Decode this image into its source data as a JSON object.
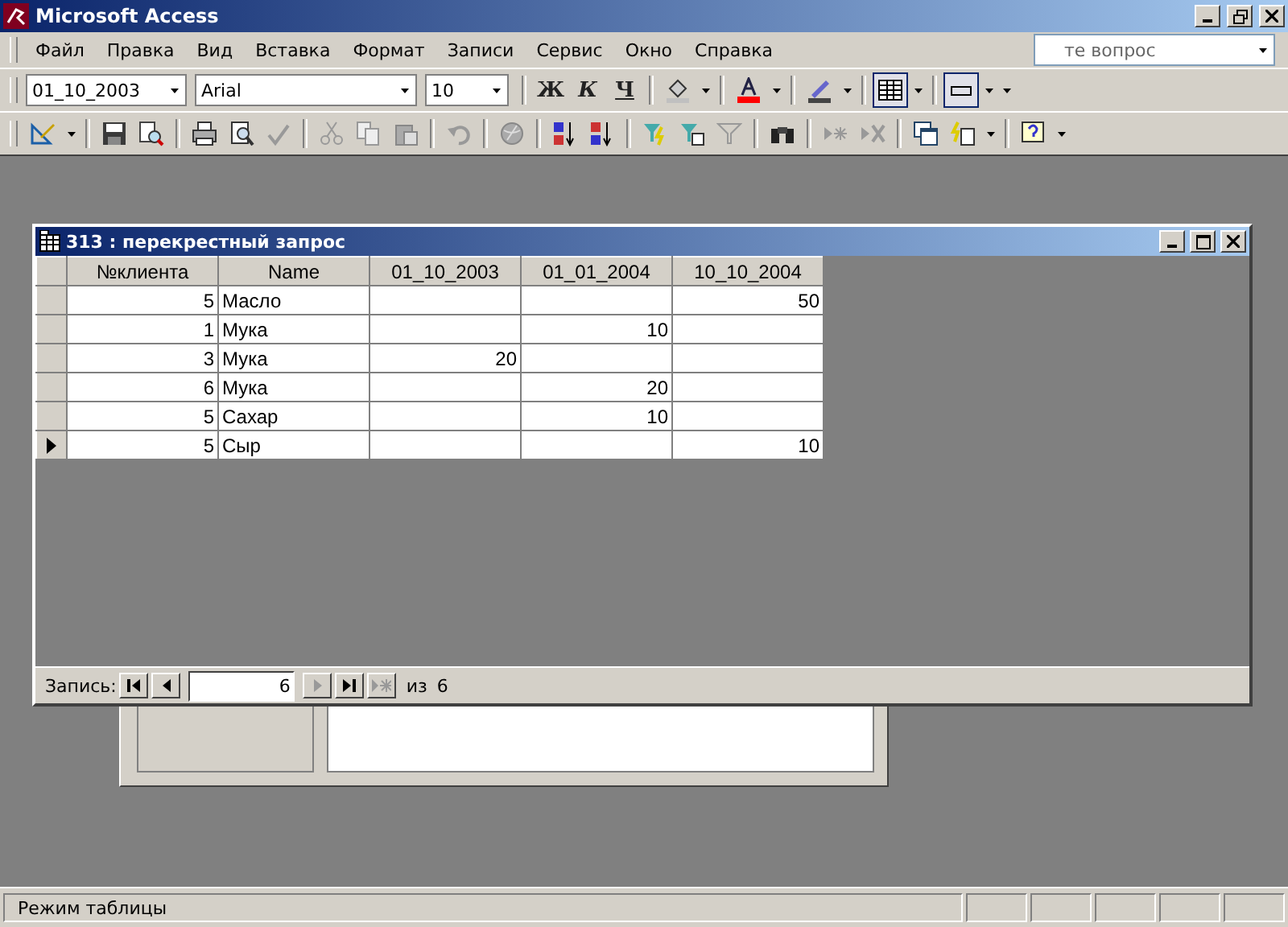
{
  "window": {
    "title": "Microsoft Access"
  },
  "menu": [
    {
      "label": "Файл"
    },
    {
      "label": "Правка"
    },
    {
      "label": "Вид"
    },
    {
      "label": "Вставка"
    },
    {
      "label": "Формат"
    },
    {
      "label": "Записи"
    },
    {
      "label": "Сервис"
    },
    {
      "label": "Окно"
    },
    {
      "label": "Справка"
    }
  ],
  "help_box": {
    "placeholder": "те вопрос"
  },
  "formatting_toolbar": {
    "object_box": "01_10_2003",
    "font_box": "Arial",
    "size_box": "10",
    "bold": "Ж",
    "italic": "К",
    "underline": "Ч"
  },
  "datasheet": {
    "title": "313 : перекрестный запрос",
    "columns": [
      "№клиента",
      "Name",
      "01_10_2003",
      "01_01_2004",
      "10_10_2004"
    ],
    "rows": [
      {
        "current": false,
        "cells": [
          "5",
          "Масло",
          "",
          "",
          "50"
        ]
      },
      {
        "current": false,
        "cells": [
          "1",
          "Мука",
          "",
          "10",
          ""
        ]
      },
      {
        "current": false,
        "cells": [
          "3",
          "Мука",
          "20",
          "",
          ""
        ]
      },
      {
        "current": false,
        "cells": [
          "6",
          "Мука",
          "",
          "20",
          ""
        ]
      },
      {
        "current": false,
        "cells": [
          "5",
          "Сахар",
          "",
          "10",
          ""
        ]
      },
      {
        "current": true,
        "cells": [
          "5",
          "Сыр",
          "",
          "",
          "10"
        ]
      }
    ],
    "navigator": {
      "label": "Запись:",
      "record": "6",
      "of_label": "из",
      "total": "6"
    }
  },
  "status_bar": {
    "text": "Режим таблицы"
  }
}
